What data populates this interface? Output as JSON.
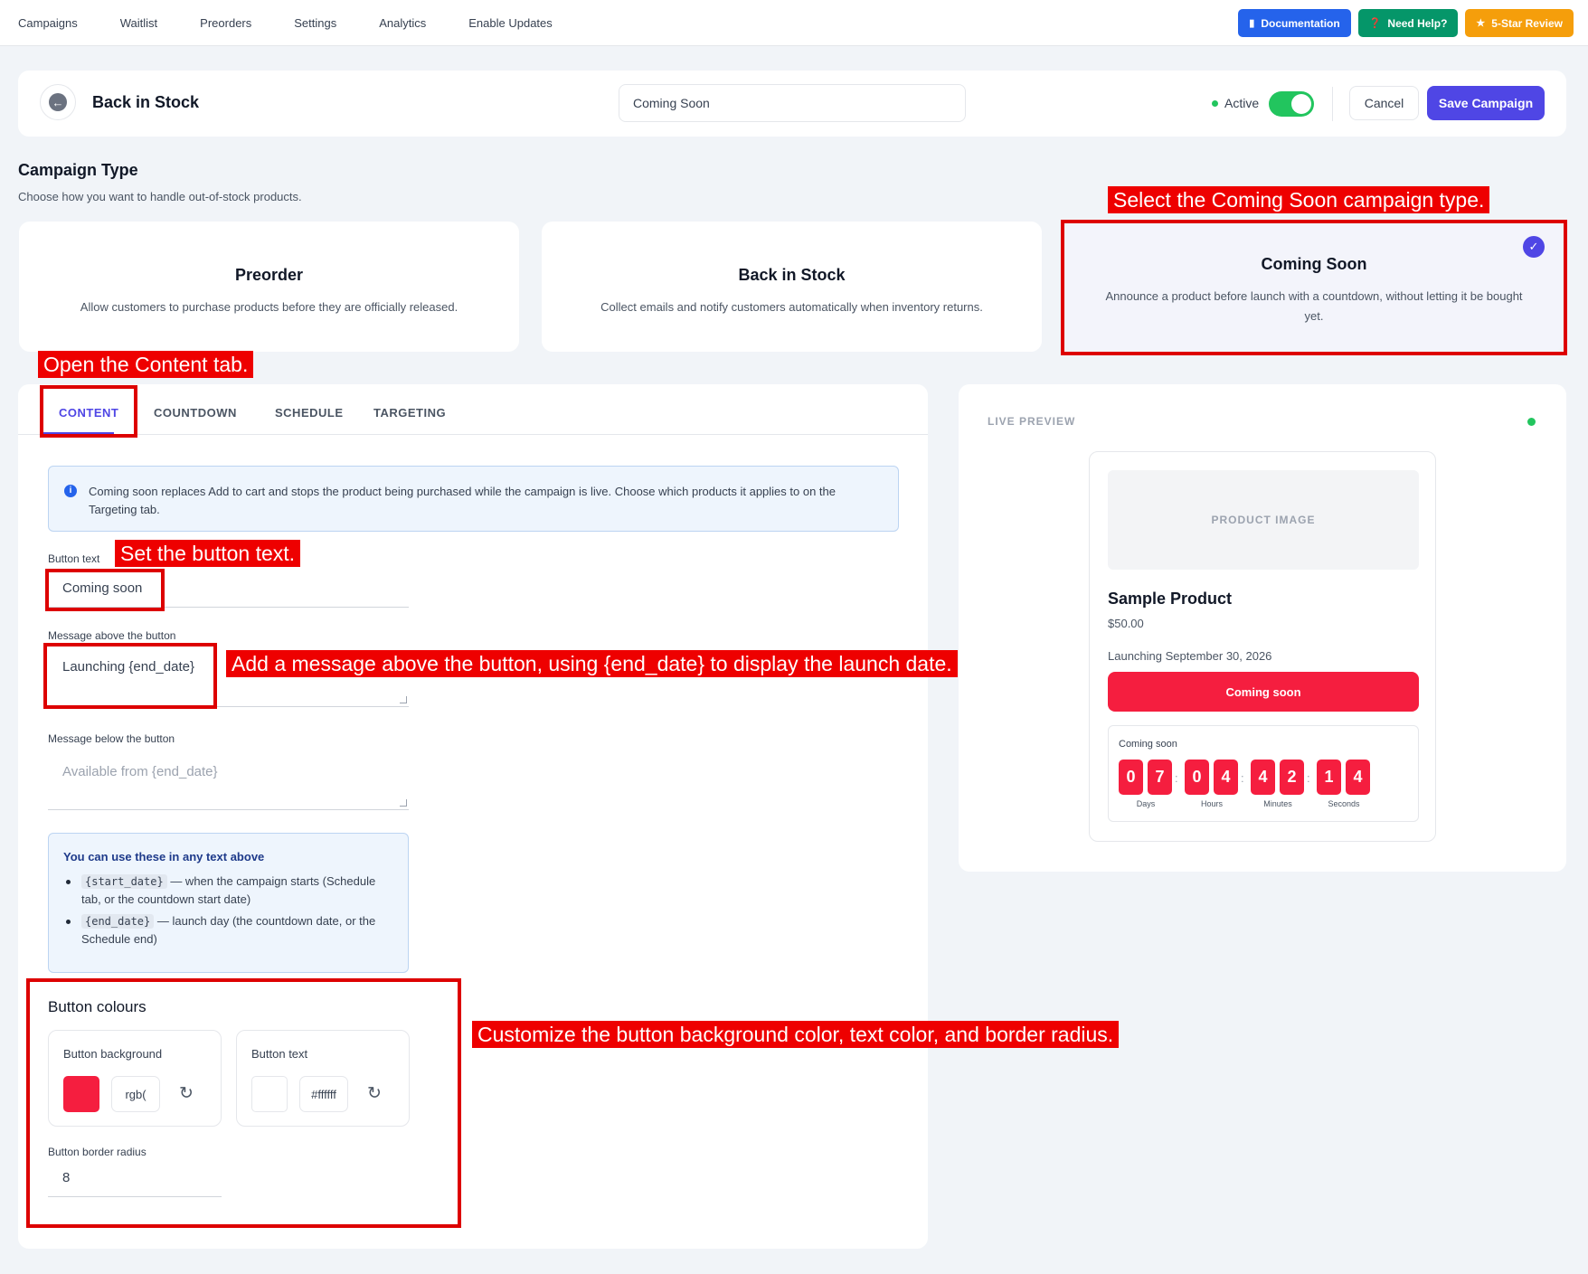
{
  "nav": {
    "links": [
      "Campaigns",
      "Waitlist",
      "Preorders",
      "Settings",
      "Analytics",
      "Enable Updates"
    ],
    "documentation": "Documentation",
    "need_help": "Need Help?",
    "review": "5-Star Review"
  },
  "header": {
    "title": "Back in Stock",
    "campaign_name": "Coming Soon",
    "active_label": "Active",
    "active_on": true,
    "cancel": "Cancel",
    "save": "Save Campaign"
  },
  "campaign_type": {
    "title": "Campaign Type",
    "subtitle": "Choose how you want to handle out-of-stock products.",
    "options": [
      {
        "title": "Preorder",
        "desc": "Allow customers to purchase products before they are officially released."
      },
      {
        "title": "Back in Stock",
        "desc": "Collect emails and notify customers automatically when inventory returns."
      },
      {
        "title": "Coming Soon",
        "desc": "Announce a product before launch with a countdown, without letting it be bought yet.",
        "selected": true
      }
    ]
  },
  "tabs": [
    "CONTENT",
    "COUNTDOWN",
    "SCHEDULE",
    "TARGETING"
  ],
  "content": {
    "info": "Coming soon replaces Add to cart and stops the product being purchased while the campaign is live. Choose which products it applies to on the Targeting tab.",
    "button_text_label": "Button text",
    "button_text_value": "Coming soon",
    "msg_above_label": "Message above the button",
    "msg_above_value": "Launching {end_date}",
    "msg_below_label": "Message below the button",
    "msg_below_placeholder": "Available from {end_date}",
    "vars": {
      "heading": "You can use these in any text above",
      "items": [
        {
          "code": "{start_date}",
          "text": " — when the campaign starts (Schedule tab, or the countdown start date)"
        },
        {
          "code": "{end_date}",
          "text": " — launch day (the countdown date, or the Schedule end)"
        }
      ]
    },
    "button_colours": {
      "title": "Button colours",
      "background_label": "Button background",
      "background_value": "rgb(",
      "background_color": "#f51e3f",
      "text_label": "Button text",
      "text_value": "#ffffff",
      "text_color": "#ffffff",
      "radius_label": "Button border radius",
      "radius_value": "8"
    }
  },
  "preview": {
    "title": "LIVE PREVIEW",
    "image_placeholder": "PRODUCT IMAGE",
    "product_name": "Sample Product",
    "price": "$50.00",
    "launch_message": "Launching September 30, 2026",
    "button_label": "Coming soon",
    "countdown_label": "Coming soon",
    "countdown": [
      {
        "digits": [
          "0",
          "7"
        ],
        "unit": "Days"
      },
      {
        "digits": [
          "0",
          "4"
        ],
        "unit": "Hours"
      },
      {
        "digits": [
          "4",
          "2"
        ],
        "unit": "Minutes"
      },
      {
        "digits": [
          "1",
          "4"
        ],
        "unit": "Seconds"
      }
    ]
  },
  "annotations": {
    "type": "Select the Coming Soon campaign type.",
    "content_tab": "Open the Content tab.",
    "button_text": "Set the button text.",
    "message": "Add a message above the button, using {end_date} to display the launch date.",
    "colours": "Customize the button background color, text color, and border radius."
  },
  "icons": {
    "back": "arrow-left-icon",
    "doc": "document-icon",
    "help": "question-circle-icon",
    "review": "star-icon",
    "check": "check-circle-icon",
    "info": "info-icon",
    "reset": "reset-icon"
  }
}
